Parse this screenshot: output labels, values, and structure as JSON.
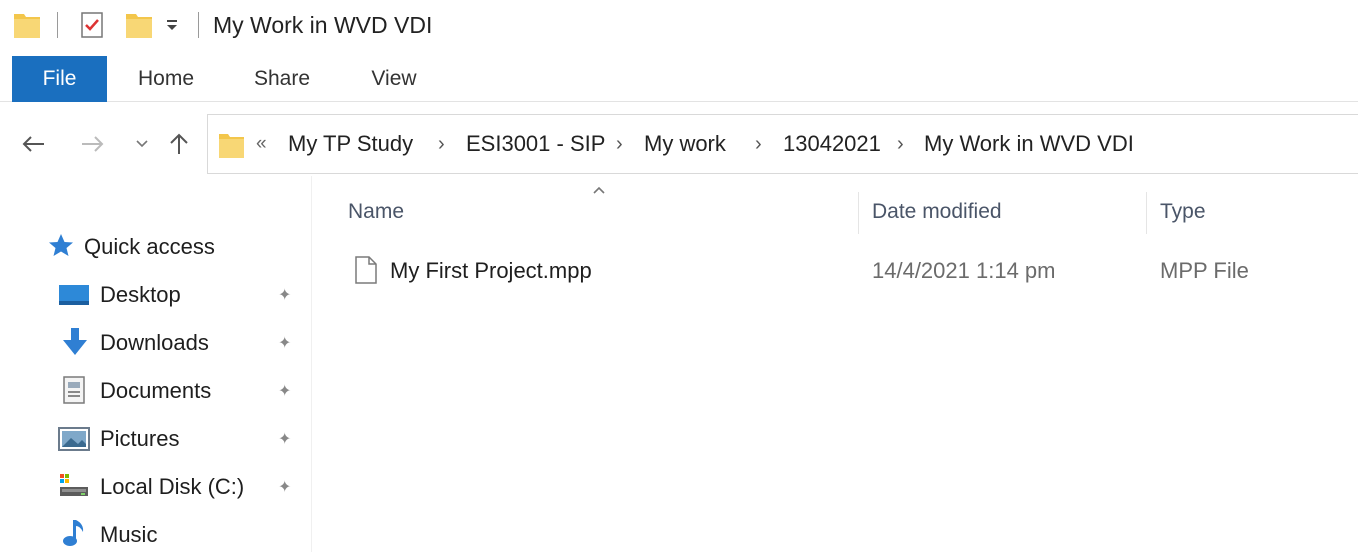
{
  "window": {
    "title": "My Work in WVD VDI"
  },
  "ribbon": {
    "tabs": [
      "File",
      "Home",
      "Share",
      "View"
    ],
    "active_tab": "File",
    "accent_color": "#1a6fbf"
  },
  "address": {
    "overflow_label": "«",
    "crumbs": [
      "My TP Study",
      "ESI3001 - SIP",
      "My work",
      "13042021",
      "My Work in WVD VDI"
    ],
    "separator": "›"
  },
  "nav_pane": {
    "quick_access_label": "Quick access",
    "items": [
      {
        "label": "Desktop",
        "icon": "desktop-icon",
        "pinned": true
      },
      {
        "label": "Downloads",
        "icon": "download-arrow-icon",
        "pinned": true
      },
      {
        "label": "Documents",
        "icon": "documents-icon",
        "pinned": true
      },
      {
        "label": "Pictures",
        "icon": "pictures-icon",
        "pinned": true
      },
      {
        "label": "Local Disk (C:)",
        "icon": "local-disk-icon",
        "pinned": true
      },
      {
        "label": "Music",
        "icon": "music-note-icon",
        "pinned": false
      }
    ]
  },
  "file_list": {
    "columns": {
      "name": "Name",
      "date": "Date modified",
      "type": "Type"
    },
    "sort_column": "Name",
    "rows": [
      {
        "name": "My First Project.mpp",
        "date": "14/4/2021 1:14 pm",
        "type": "MPP File"
      }
    ]
  }
}
